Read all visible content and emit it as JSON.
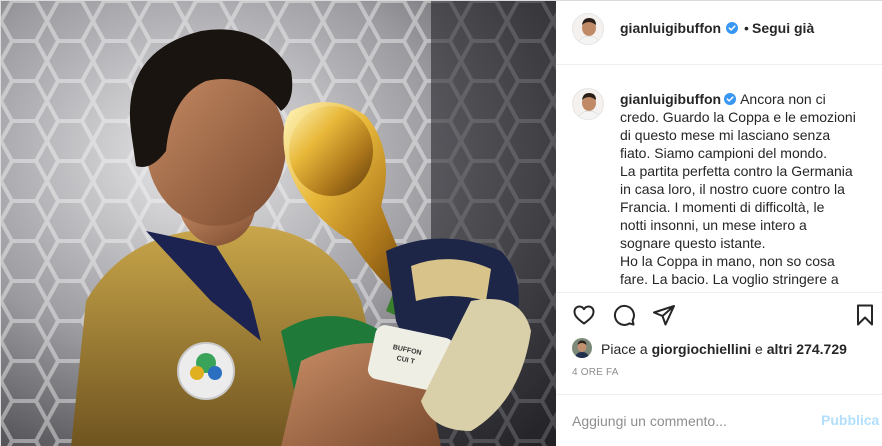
{
  "post": {
    "author": "gianluigibuffon",
    "follow_sep": "•",
    "follow_label": "Segui già",
    "caption_lines": [
      "Ancora non ci",
      "credo. Guardo la Coppa e le emozioni",
      "di questo mese mi lasciano senza",
      "fiato. Siamo campioni del mondo.",
      "La partita perfetta contro la Germania",
      "in casa loro, il nostro cuore contro la",
      "Francia. I momenti di difficoltà, le",
      "notti insonni, un mese intero a",
      "sognare questo istante.",
      "Ho la Coppa in mano, non so cosa",
      "fare. La bacio. La voglio stringere a"
    ],
    "likes_prefix": "Piace a ",
    "likes_user": "giorgiochiellini",
    "likes_and": " e ",
    "likes_others": "altri 274.729",
    "timestamp": "4 ore fa",
    "comment_placeholder": "Aggiungi un commento...",
    "publish_label": "Pubblica",
    "glove_text": "BUFFON\nCUI T",
    "patch_text": "2006 FIFA"
  },
  "colors": {
    "verified": "#3897f0",
    "muted": "#8e8e8e",
    "publish_disabled": "#b2dffc",
    "text": "#262626"
  },
  "icons": [
    "verified-icon",
    "heart-icon",
    "comment-icon",
    "share-icon",
    "bookmark-icon"
  ]
}
